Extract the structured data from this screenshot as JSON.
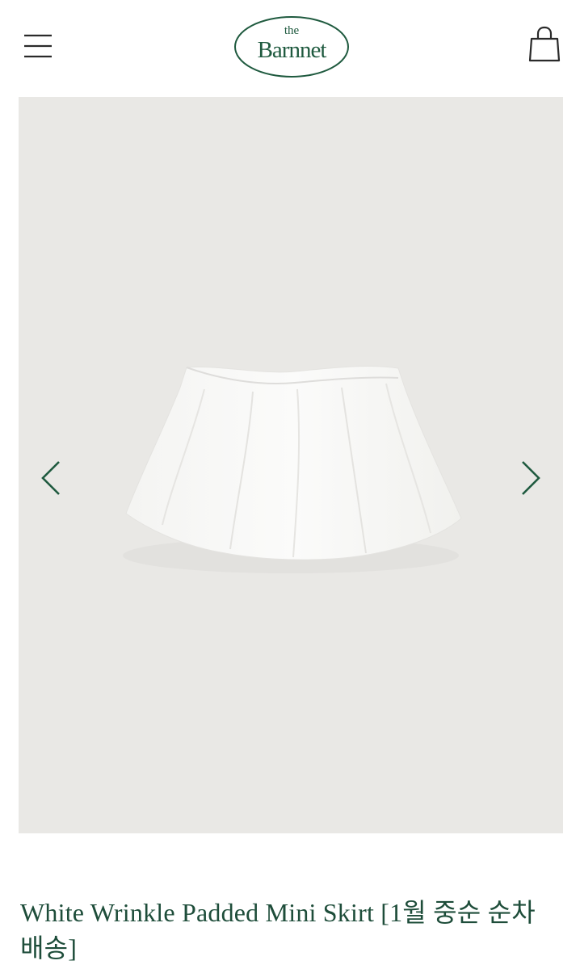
{
  "header": {
    "menu_icon": "hamburger-menu-icon",
    "logo": {
      "small_text": "the",
      "main_text": "Barnnet"
    },
    "cart_icon": "shopping-bag-icon"
  },
  "gallery": {
    "prev_icon": "chevron-left-icon",
    "next_icon": "chevron-right-icon",
    "image_subject": "white-mini-skirt"
  },
  "product": {
    "title": "White Wrinkle Padded Mini Skirt [1월 중순 순차 배송]"
  },
  "colors": {
    "brand_green": "#1f5a3f",
    "title_green": "#1e4d3a",
    "image_background": "#e9e8e5"
  }
}
